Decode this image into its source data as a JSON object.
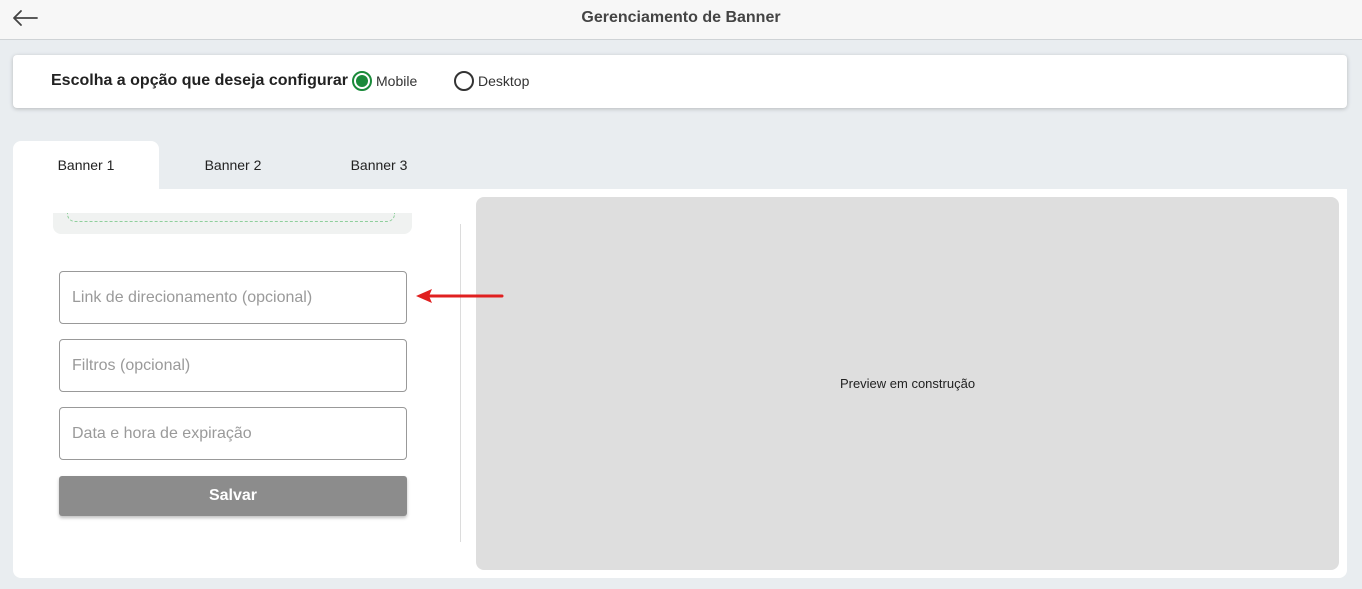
{
  "header": {
    "title": "Gerenciamento de Banner",
    "back_icon": "arrow-left-icon"
  },
  "options": {
    "label": "Escolha a opção que deseja configurar",
    "radios": [
      {
        "label": "Mobile",
        "checked": true
      },
      {
        "label": "Desktop",
        "checked": false
      }
    ]
  },
  "tabs": [
    {
      "label": "Banner 1",
      "active": true
    },
    {
      "label": "Banner 2",
      "active": false
    },
    {
      "label": "Banner 3",
      "active": false
    }
  ],
  "form": {
    "link_placeholder": "Link de direcionamento (opcional)",
    "filtros_placeholder": "Filtros (opcional)",
    "data_placeholder": "Data e hora de expiração",
    "save_label": "Salvar"
  },
  "preview": {
    "text": "Preview em construção"
  },
  "colors": {
    "accent_green": "#1a8a3a",
    "save_button": "#8c8c8c",
    "annotation_red": "#e02020"
  }
}
